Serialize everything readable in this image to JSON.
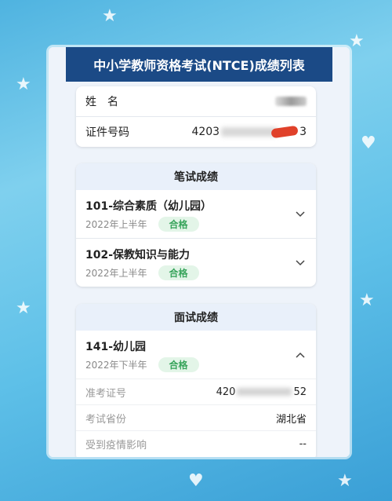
{
  "header": {
    "title": "中小学教师资格考试(NTCE)成绩列表"
  },
  "personal": {
    "name_label": "姓　名",
    "id_label": "证件号码",
    "id_prefix": "4203",
    "id_suffix": "3"
  },
  "written": {
    "heading": "笔试成绩",
    "subjects": [
      {
        "title": "101-综合素质（幼儿园）",
        "period": "2022年上半年",
        "result": "合格",
        "icon": "chevron-down-icon"
      },
      {
        "title": "102-保教知识与能力",
        "period": "2022年上半年",
        "result": "合格",
        "icon": "chevron-down-icon"
      }
    ]
  },
  "interview": {
    "heading": "面试成绩",
    "subject": {
      "title": "141-幼儿园",
      "period": "2022年下半年",
      "result": "合格",
      "icon": "chevron-up-icon"
    },
    "details": {
      "ticket_label": "准考证号",
      "ticket_prefix": "420",
      "ticket_suffix": "52",
      "province_label": "考试省份",
      "province_value": "湖北省",
      "covid_label": "受到疫情影响",
      "covid_value": "--"
    }
  },
  "colors": {
    "header_bg": "#1b4a86",
    "badge_text": "#3aa55d",
    "badge_bg": "#e3f5e8"
  }
}
